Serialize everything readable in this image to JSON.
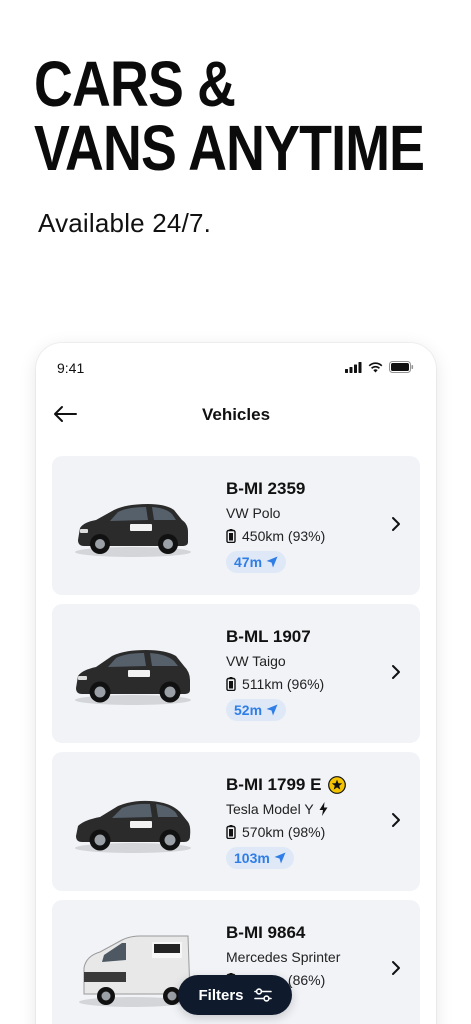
{
  "hero": {
    "title_line1": "CARS &",
    "title_line2": "VANS ANYTIME",
    "subtitle": "Available 24/7."
  },
  "statusbar": {
    "time": "9:41"
  },
  "nav": {
    "title": "Vehicles",
    "back_icon": "arrow-left-icon"
  },
  "vehicles": [
    {
      "plate": "B-MI 2359",
      "model": "VW Polo",
      "range": "450km (93%)",
      "distance": "47m",
      "body_color": "#2b2b2b",
      "type": "hatchback"
    },
    {
      "plate": "B-ML 1907",
      "model": "VW Taigo",
      "range": "511km (96%)",
      "distance": "52m",
      "body_color": "#2b2b2b",
      "type": "suv"
    },
    {
      "plate": "B-MI 1799 E",
      "model": "Tesla Model Y",
      "range": "570km (98%)",
      "distance": "103m",
      "body_color": "#2b2b2b",
      "type": "tesla",
      "badge": "star-icon",
      "electric_icon": "lightning-icon"
    },
    {
      "plate": "B-MI 9864",
      "model": "Mercedes Sprinter",
      "range": "577km (86%)",
      "distance": "",
      "body_color": "#e8e8e8",
      "type": "van"
    }
  ],
  "filters": {
    "label": "Filters",
    "icon": "sliders-icon"
  },
  "colors": {
    "card_bg": "#f1f3f7",
    "accent_blue": "#2f7ee8",
    "distance_chip_bg": "#dfe8f6",
    "filter_btn_bg": "#0f1b2d",
    "star_yellow": "#f5c400"
  }
}
